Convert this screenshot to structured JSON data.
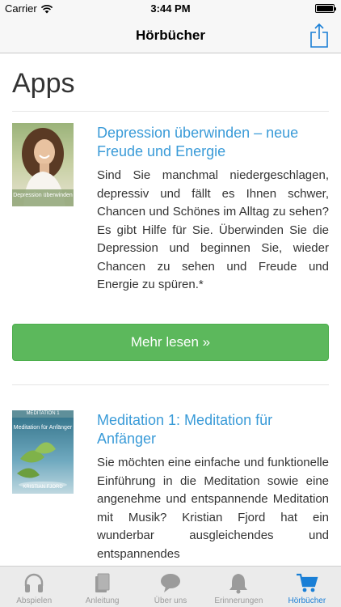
{
  "status_bar": {
    "carrier": "Carrier",
    "time": "3:44 PM"
  },
  "nav": {
    "title": "Hörbücher",
    "share_icon": "share-icon"
  },
  "section": {
    "title": "Apps"
  },
  "items": [
    {
      "title": "Depression überwinden – neue Freude und Energie",
      "description": "Sind Sie manchmal niedergeschlagen, depressiv und fällt es Ihnen schwer, Chancen und Schönes im Alltag zu sehen? Es gibt Hilfe für Sie. Überwinden Sie die Depression und beginnen Sie, wieder Chancen zu sehen und Freude und Energie zu spüren.*",
      "cover_text": "Depression überwinden",
      "button_label": "Mehr lesen »"
    },
    {
      "title": "Meditation 1: Meditation für Anfänger",
      "description": "Sie möchten eine einfache und funktionelle Einführung in die Meditation sowie eine angenehme und entspannende Meditation mit Musik? Kristian Fjord hat ein wunderbar ausgleichendes und entspannendes",
      "cover_label": "MEDITATION 1",
      "cover_text": "Meditation für Anfänger",
      "cover_author": "KRISTIAN FJORD"
    }
  ],
  "tabs": [
    {
      "label": "Abspielen",
      "icon": "headphones-icon",
      "active": false
    },
    {
      "label": "Anleitung",
      "icon": "books-icon",
      "active": false
    },
    {
      "label": "Über uns",
      "icon": "chat-bubble-icon",
      "active": false
    },
    {
      "label": "Erinnerungen",
      "icon": "bell-icon",
      "active": false
    },
    {
      "label": "Hörbücher",
      "icon": "cart-icon",
      "active": true
    }
  ],
  "colors": {
    "accent": "#1a7fd6",
    "link_title": "#3a9bd8",
    "button_green": "#5cb85c",
    "inactive_tab": "#9b9b9b"
  }
}
